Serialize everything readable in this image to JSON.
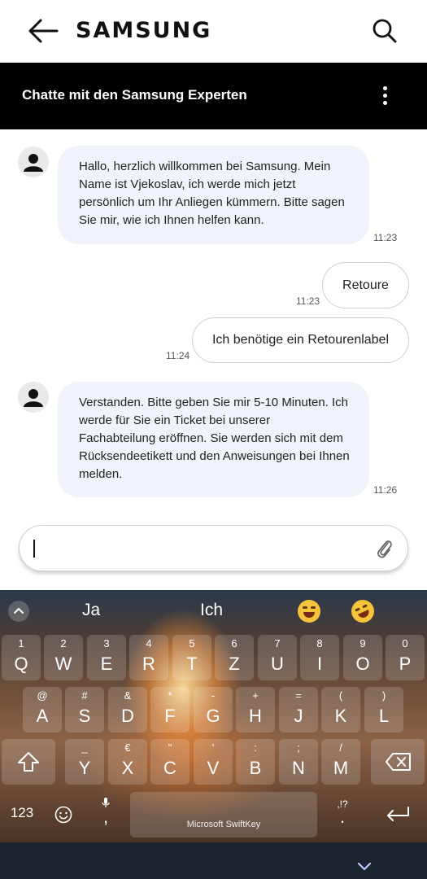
{
  "header": {
    "logo": "SAMSUNG"
  },
  "titlebar": {
    "title": "Chatte mit den Samsung Experten"
  },
  "messages": {
    "m1": {
      "text": "Hallo, herzlich willkommen bei Samsung. Mein Name ist Vjekoslav, ich werde mich jetzt persönlich um Ihr Anliegen kümmern. Bitte sagen Sie mir, wie ich Ihnen helfen kann.",
      "time": "11:23"
    },
    "m2": {
      "text": "Retoure",
      "time": "11:23"
    },
    "m3": {
      "text": "Ich benötige ein Retourenlabel",
      "time": "11:24"
    },
    "m4": {
      "text": "Verstanden. Bitte geben Sie mir 5-10 Minuten. Ich werde für Sie ein Ticket bei unserer Fachabteilung eröffnen. Sie werden sich mit dem Rücksendeetikett und den Anweisungen bei Ihnen melden.",
      "time": "11:26"
    }
  },
  "keyboard": {
    "suggestions": [
      "Ja",
      "Ich"
    ],
    "emojis": [
      "tears-of-joy-emoji",
      "rolling-laughing-emoji"
    ],
    "row1": [
      {
        "main": "Q",
        "alt": "1"
      },
      {
        "main": "W",
        "alt": "2"
      },
      {
        "main": "E",
        "alt": "3"
      },
      {
        "main": "R",
        "alt": "4"
      },
      {
        "main": "T",
        "alt": "5"
      },
      {
        "main": "Z",
        "alt": "6"
      },
      {
        "main": "U",
        "alt": "7"
      },
      {
        "main": "I",
        "alt": "8"
      },
      {
        "main": "O",
        "alt": "9"
      },
      {
        "main": "P",
        "alt": "0"
      }
    ],
    "row2": [
      {
        "main": "A",
        "alt": "@"
      },
      {
        "main": "S",
        "alt": "#"
      },
      {
        "main": "D",
        "alt": "&"
      },
      {
        "main": "F",
        "alt": "*"
      },
      {
        "main": "G",
        "alt": "-"
      },
      {
        "main": "H",
        "alt": "+"
      },
      {
        "main": "J",
        "alt": "="
      },
      {
        "main": "K",
        "alt": "("
      },
      {
        "main": "L",
        "alt": ")"
      }
    ],
    "row3": [
      {
        "main": "Y",
        "alt": "_"
      },
      {
        "main": "X",
        "alt": "€"
      },
      {
        "main": "C",
        "alt": "\""
      },
      {
        "main": "V",
        "alt": "'"
      },
      {
        "main": "B",
        "alt": ":"
      },
      {
        "main": "N",
        "alt": ";"
      },
      {
        "main": "M",
        "alt": "/"
      }
    ],
    "numbers_label": "123",
    "comma_label": ",",
    "period_label": ".",
    "period_alt": ",!?",
    "space_label": "Microsoft SwiftKey"
  },
  "colors": {
    "header_bg": "#000000",
    "incoming_bubble": "#f1f3fa",
    "navbar": "#1c2430"
  }
}
